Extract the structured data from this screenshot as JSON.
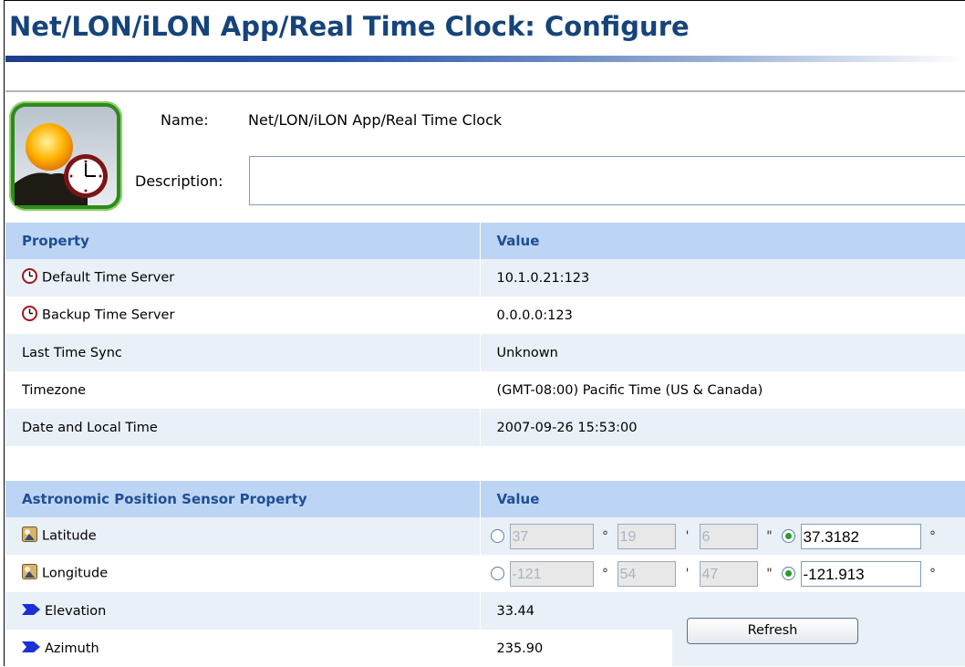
{
  "page": {
    "title": "Net/LON/iLON App/Real Time Clock: Configure"
  },
  "header": {
    "name_label": "Name:",
    "name_value": "Net/LON/iLON App/Real Time Clock",
    "description_label": "Description:",
    "description_value": ""
  },
  "properties": {
    "col_property": "Property",
    "col_value": "Value",
    "rows": [
      {
        "label": "Default Time Server",
        "value": "10.1.0.21:123",
        "icon": "clock-icon"
      },
      {
        "label": "Backup Time Server",
        "value": "0.0.0.0:123",
        "icon": "clock-icon"
      },
      {
        "label": "Last Time Sync",
        "value": "Unknown",
        "icon": ""
      },
      {
        "label": "Timezone",
        "value": "(GMT-08:00) Pacific Time (US & Canada)",
        "icon": ""
      },
      {
        "label": "Date and Local Time",
        "value": "2007-09-26 15:53:00",
        "icon": ""
      }
    ]
  },
  "astronomic": {
    "col_property": "Astronomic Position Sensor Property",
    "col_value": "Value",
    "latitude": {
      "label": "Latitude",
      "deg": "37",
      "min": "19",
      "sec": "6",
      "decimal": "37.3182",
      "deg_unit": "°",
      "min_unit": "'",
      "sec_unit": "\"",
      "decimal_unit": "°"
    },
    "longitude": {
      "label": "Longitude",
      "deg": "-121",
      "min": "54",
      "sec": "47",
      "decimal": "-121.913",
      "deg_unit": "°",
      "min_unit": "'",
      "sec_unit": "\"",
      "decimal_unit": "°"
    },
    "elevation": {
      "label": "Elevation",
      "value": "33.44"
    },
    "azimuth": {
      "label": "Azimuth",
      "value": "235.90"
    },
    "refresh_label": "Refresh"
  },
  "colors": {
    "title": "#16447a",
    "header_bg": "#bcd5f5",
    "header_text": "#1f4e93",
    "row_alt": "#eaf0f8"
  }
}
